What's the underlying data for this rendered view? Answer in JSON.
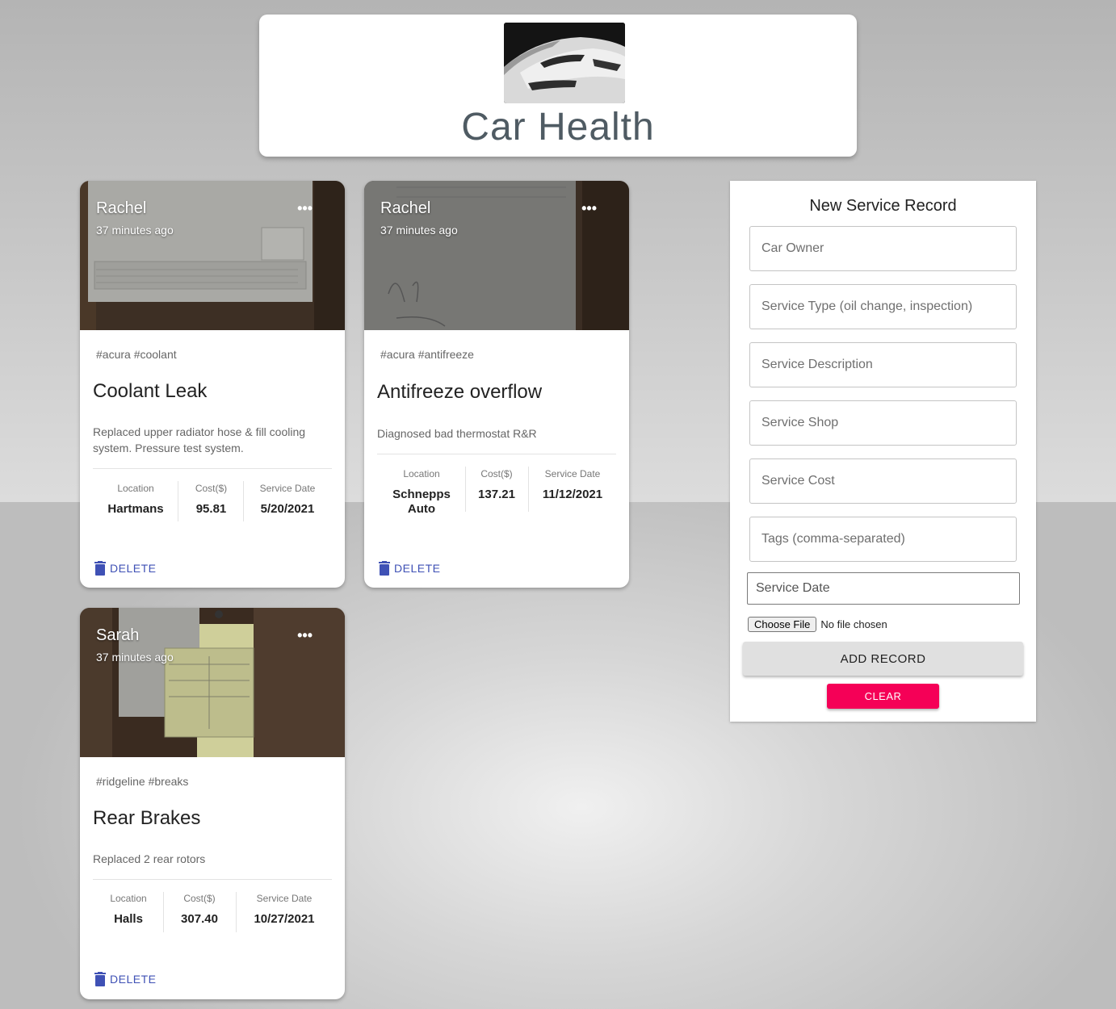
{
  "app": {
    "title": "Car Health",
    "logo_icon": "sports-car-image"
  },
  "records": [
    {
      "owner": "Rachel",
      "time": "37 minutes ago",
      "more": "•••",
      "tags": "#acura #coolant",
      "title": "Coolant Leak",
      "description": "Replaced upper radiator hose & fill cooling system. Pressure test system.",
      "location_label": "Location",
      "location": "Hartmans",
      "cost_label": "Cost($)",
      "cost": "95.81",
      "date_label": "Service Date",
      "date": "5/20/2021",
      "delete_label": "DELETE"
    },
    {
      "owner": "Rachel",
      "time": "37 minutes ago",
      "more": "•••",
      "tags": "#acura #antifreeze",
      "title": "Antifreeze overflow",
      "description": "Diagnosed bad thermostat R&R",
      "location_label": "Location",
      "location": "Schnepps Auto",
      "cost_label": "Cost($)",
      "cost": "137.21",
      "date_label": "Service Date",
      "date": "11/12/2021",
      "delete_label": "DELETE"
    },
    {
      "owner": "Sarah",
      "time": "37 minutes ago",
      "more": "•••",
      "tags": "#ridgeline #breaks",
      "title": "Rear Brakes",
      "description": "Replaced 2 rear rotors",
      "location_label": "Location",
      "location": "Halls",
      "cost_label": "Cost($)",
      "cost": "307.40",
      "date_label": "Service Date",
      "date": "10/27/2021",
      "delete_label": "DELETE"
    }
  ],
  "form": {
    "title": "New Service Record",
    "fields": {
      "owner": "Car Owner",
      "type": "Service Type (oil change, inspection)",
      "description": "Service Description",
      "shop": "Service Shop",
      "cost": "Service Cost",
      "tags": "Tags (comma-separated)",
      "date": "Service Date"
    },
    "file_button": "Choose File",
    "file_status": "No file chosen",
    "add_label": "ADD RECORD",
    "clear_label": "CLEAR"
  },
  "colors": {
    "accent": "#3f51b5",
    "danger": "#f50057",
    "title_text": "#4f5b63"
  }
}
